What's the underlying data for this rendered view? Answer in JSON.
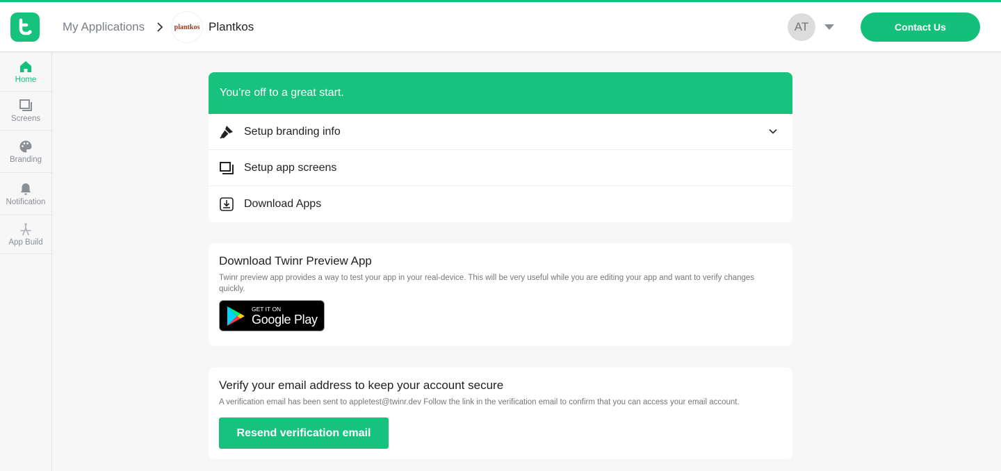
{
  "header": {
    "breadcrumb_root": "My Applications",
    "app_logo_text": "plantkos",
    "app_name": "Plantkos",
    "avatar_initials": "AT",
    "contact_label": "Contact Us"
  },
  "sidebar": {
    "items": [
      {
        "label": "Home",
        "icon": "home-icon",
        "active": true
      },
      {
        "label": "Screens",
        "icon": "screens-icon"
      },
      {
        "label": "Branding",
        "icon": "palette-icon"
      },
      {
        "label": "Notification",
        "icon": "bell-icon"
      },
      {
        "label": "App Build",
        "icon": "app-build-icon"
      }
    ]
  },
  "setup": {
    "banner": "You’re off to a great start.",
    "steps": [
      {
        "label": "Setup branding info",
        "icon": "branding-icon"
      },
      {
        "label": "Setup app screens",
        "icon": "screens-icon"
      },
      {
        "label": "Download Apps",
        "icon": "download-icon"
      }
    ]
  },
  "preview": {
    "title": "Download Twinr Preview App",
    "description": "Twinr preview app provides a way to test your app in your real-device. This will be very useful while you are editing your app and want to verify changes quickly.",
    "badge_small": "GET IT ON",
    "badge_big": "Google Play"
  },
  "verify": {
    "title": "Verify your email address to keep your account secure",
    "description": "A verification email has been sent to appletest@twinr.dev Follow the link in the verification email to confirm that you can access your email account.",
    "button": "Resend verification email"
  },
  "colors": {
    "brand": "#12c07a",
    "text": "#222222",
    "muted": "#7a7f87"
  }
}
